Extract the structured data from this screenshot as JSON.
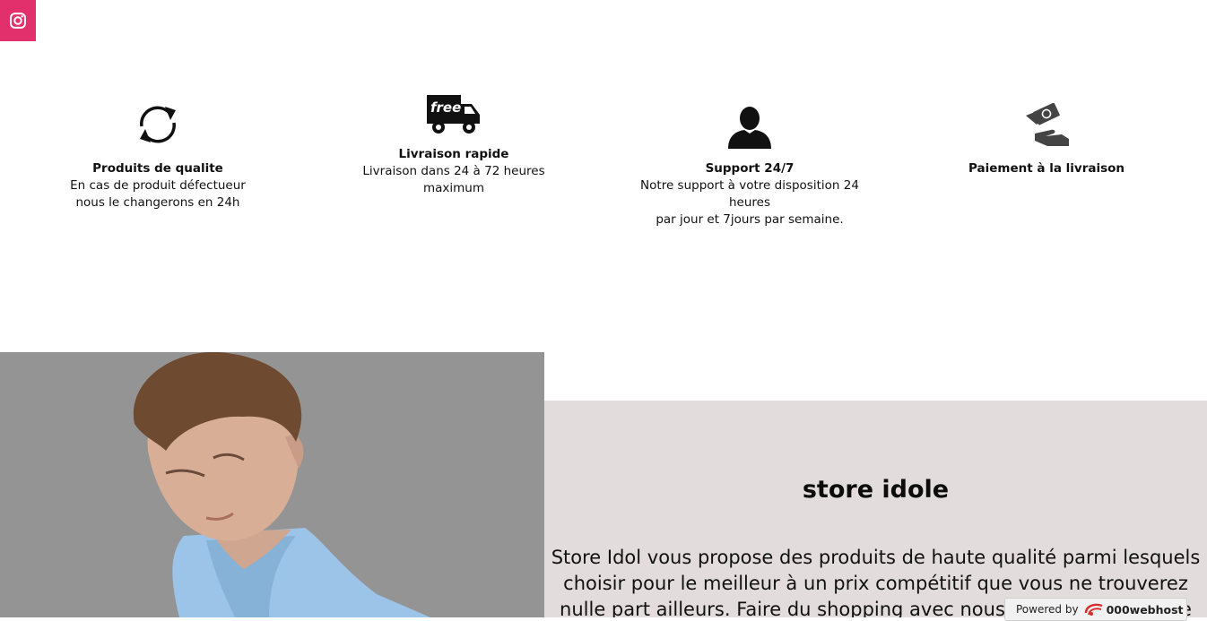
{
  "social": {
    "instagram_icon": "instagram-icon",
    "color": "#e1306c"
  },
  "features": [
    {
      "icon": "refresh-icon",
      "title": "Produits de qualite",
      "desc": "En cas de produit défectueur\nnous le changerons en 24h"
    },
    {
      "icon": "free-delivery-truck-icon",
      "title": "Livraison rapide",
      "desc": "Livraison dans 24 à 72 heures maximum",
      "icon_text": "free"
    },
    {
      "icon": "user-icon",
      "title": "Support 24/7",
      "desc": "Notre support à votre disposition 24\nheures\npar jour et 7jours par semaine."
    },
    {
      "icon": "cash-payment-icon",
      "title": "Paiement à la livraison",
      "desc": ""
    }
  ],
  "about": {
    "title": "store idole",
    "text": "Store Idol vous propose des produits de haute qualité parmi lesquels choisir pour le meilleur à un prix compétitif que vous ne trouverez nulle part ailleurs. Faire du shopping avec nous est une expérience"
  },
  "badge": {
    "powered": "Powered by",
    "brand": "000webhost"
  },
  "colors": {
    "about_bg": "#e3dcdc",
    "photo_bg": "#949494"
  }
}
